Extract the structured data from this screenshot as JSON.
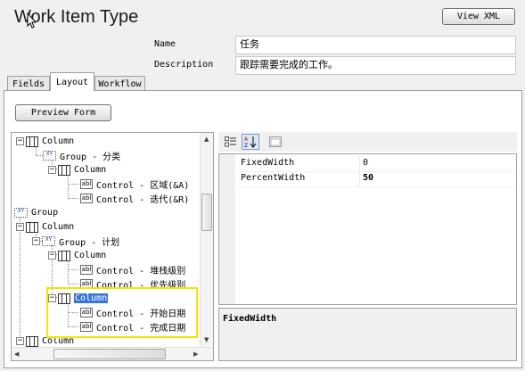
{
  "header": {
    "title": "Work Item Type",
    "view_xml_label": "View XML"
  },
  "form": {
    "name_label": "Name",
    "name_value": "任务",
    "description_label": "Description",
    "description_value": "跟踪需要完成的工作。"
  },
  "tabs": [
    {
      "label": "Fields",
      "active": false
    },
    {
      "label": "Layout",
      "active": true
    },
    {
      "label": "Workflow",
      "active": false
    }
  ],
  "layout": {
    "preview_label": "Preview Form"
  },
  "tree": {
    "nodes": [
      {
        "label": "Column",
        "kind": "column"
      },
      {
        "label": "Group - 分类",
        "kind": "group"
      },
      {
        "label": "Column",
        "kind": "column"
      },
      {
        "label": "Control - 区域(&A)",
        "kind": "control"
      },
      {
        "label": "Control - 迭代(&R)",
        "kind": "control"
      },
      {
        "label": "Group",
        "kind": "group"
      },
      {
        "label": "Column",
        "kind": "column"
      },
      {
        "label": "Group - 计划",
        "kind": "group"
      },
      {
        "label": "Column",
        "kind": "column"
      },
      {
        "label": "Control - 堆栈级别",
        "kind": "control"
      },
      {
        "label": "Control - 优先级别",
        "kind": "control"
      },
      {
        "label": "Column",
        "kind": "column",
        "selected": true
      },
      {
        "label": "Control - 开始日期",
        "kind": "control"
      },
      {
        "label": "Control - 完成日期",
        "kind": "control"
      },
      {
        "label": "Column",
        "kind": "column"
      }
    ],
    "control_icon_text": "abl",
    "group_icon_text": "XY"
  },
  "properties": {
    "rows": [
      {
        "name": "FixedWidth",
        "value": "0"
      },
      {
        "name": "PercentWidth",
        "value": "50"
      }
    ],
    "description_title": "FixedWidth"
  },
  "icons": [
    "categorized-icon",
    "alphabetical-sort-icon",
    "property-pages-icon",
    "expand-icon",
    "collapse-icon",
    "column-icon",
    "group-icon",
    "control-icon",
    "mouse-cursor-icon"
  ],
  "colors": {
    "selection": "#3875d7",
    "highlight_border": "#f2e600"
  }
}
